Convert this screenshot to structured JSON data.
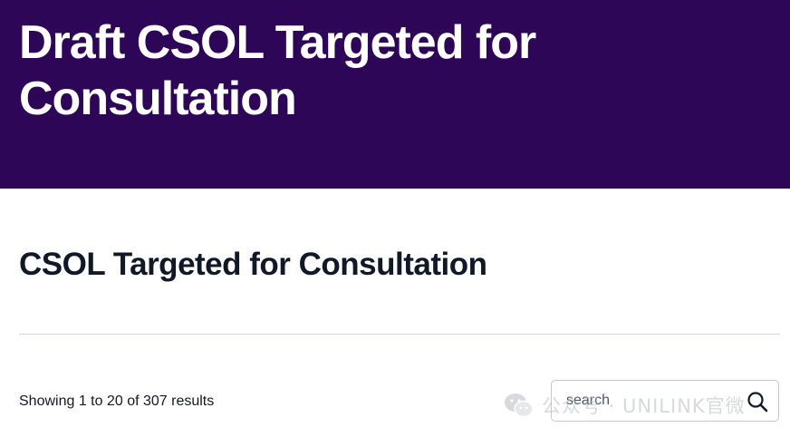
{
  "header": {
    "title": "Draft CSOL Targeted for Consultation"
  },
  "main": {
    "section_title": "CSOL Targeted for Consultation",
    "results_summary": "Showing 1 to 20 of 307 results",
    "search": {
      "placeholder": "search",
      "value": ""
    }
  },
  "watermark": {
    "text": "公众号 · UNILINK官微",
    "icon": "wechat-icon"
  },
  "colors": {
    "hero_background": "#2d0657",
    "hero_text": "#ffffff",
    "body_text": "#111827"
  }
}
